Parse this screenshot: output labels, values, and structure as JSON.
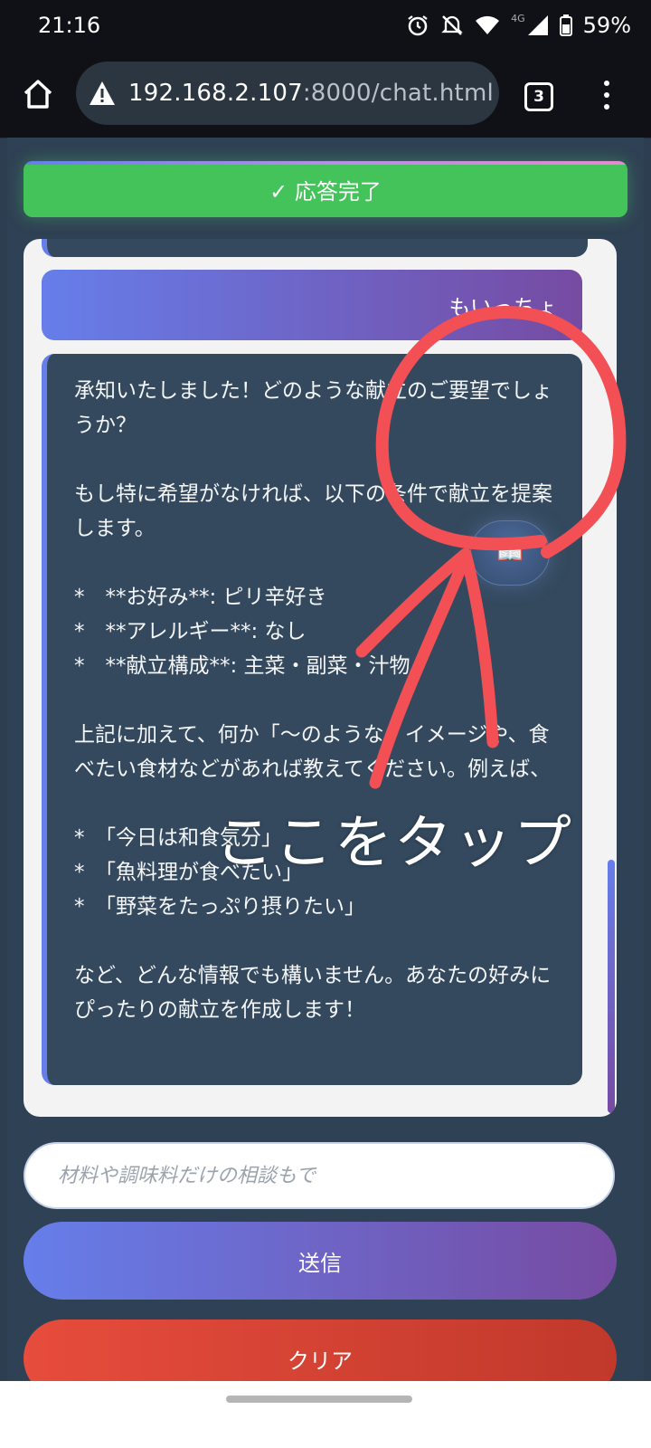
{
  "status_bar": {
    "time": "21:16",
    "network": "4G",
    "battery": "59%",
    "icons": [
      "alarm-icon",
      "mute-icon",
      "wifi-icon",
      "cellular-icon",
      "battery-icon"
    ]
  },
  "browser": {
    "url_host": "192.168.2.107",
    "url_rest": ":8000/chat.html",
    "tab_count": "3",
    "icons": [
      "home-icon",
      "warning-icon",
      "tabs-icon",
      "menu-icon"
    ]
  },
  "status_banner": {
    "text": "✓ 応答完了",
    "color": "#44c35a"
  },
  "chat": {
    "user_message": "もいっちょ",
    "bot_message": "承知いたしました！どのような献立のご要望でしょうか？\n\nもし特に希望がなければ、以下の条件で献立を提案します。\n\n*　**お好み**: ピリ辛好き\n*　**アレルギー**: なし\n*　**献立構成**: 主菜・副菜・汁物\n\n上記に加えて、何か「〜のような」イメージや、食べたい食材などがあれば教えてください。例えば、\n\n*　「今日は和食気分」\n*　「魚料理が食べたい」\n*　「野菜をたっぷり摂りたい」\n\nなど、どんな情報でも構いません。あなたの好みにぴったりの献立を作成します！",
    "floating_button_icon": "📖"
  },
  "input": {
    "placeholder": "材料や調味料だけの相談もで",
    "value": ""
  },
  "buttons": {
    "send": "送信",
    "clear": "クリア"
  },
  "annotation": {
    "text": "ここをタップ",
    "color": "#f25055"
  },
  "colors": {
    "accent_start": "#667eea",
    "accent_end": "#764ba2",
    "bot_bubble": "#34495e"
  }
}
